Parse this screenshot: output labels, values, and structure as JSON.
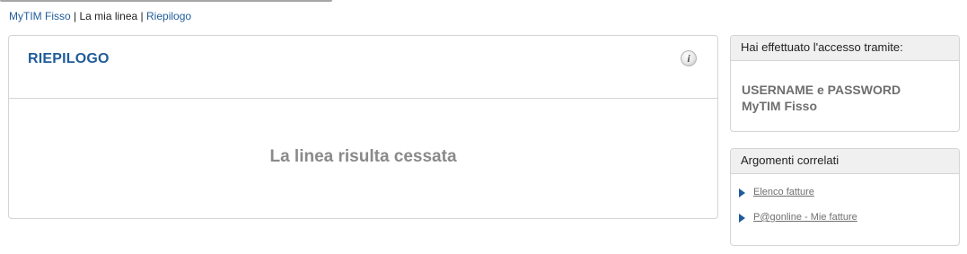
{
  "breadcrumb": {
    "items": [
      "MyTIM Fisso",
      "La mia linea",
      "Riepilogo"
    ],
    "separator": "|"
  },
  "main": {
    "title": "RIEPILOGO",
    "info_icon": "info-icon",
    "message": "La linea risulta cessata"
  },
  "access": {
    "header": "Hai effettuato l'accesso tramite:",
    "line1": "USERNAME e PASSWORD",
    "line2": "MyTIM Fisso"
  },
  "related": {
    "header": "Argomenti correlati",
    "links": [
      "Elenco fatture",
      "P@gonline - Mie fatture"
    ]
  },
  "colors": {
    "link_blue": "#1f5c99",
    "muted_gray": "#8a8a8a",
    "border": "#d4d4d4"
  }
}
